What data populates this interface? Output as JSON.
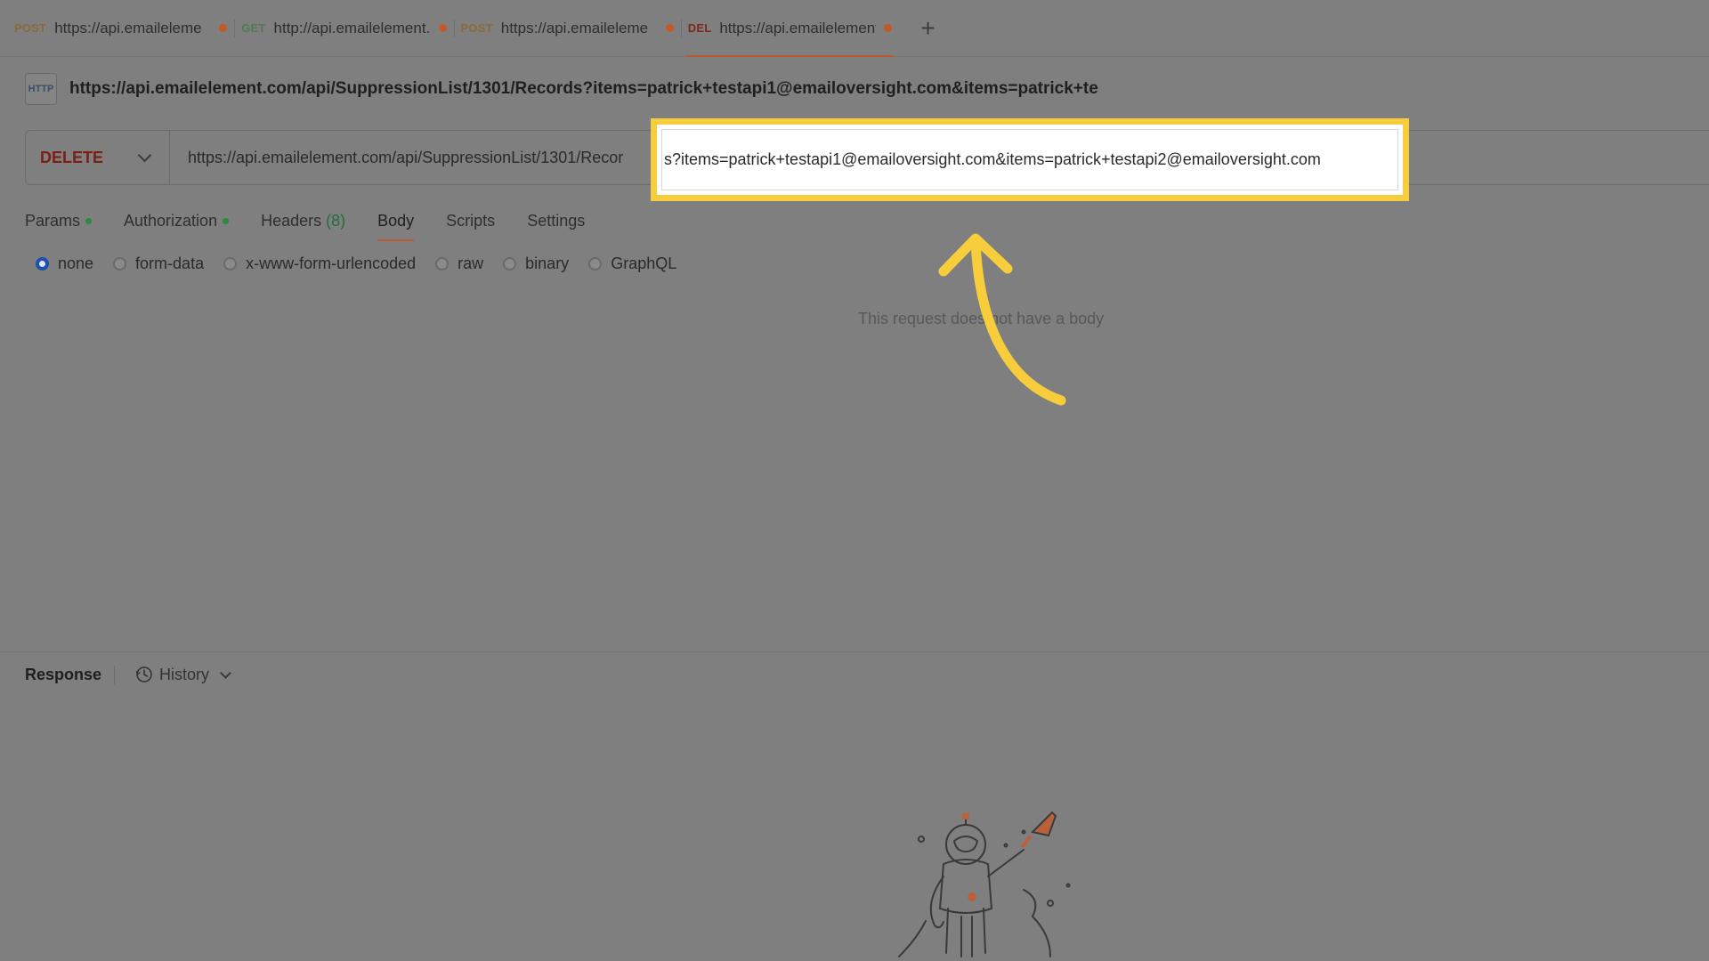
{
  "tabs": [
    {
      "method": "POST",
      "url": "https://api.emaileleme",
      "active": false
    },
    {
      "method": "GET",
      "url": "http://api.emailelement.",
      "active": false
    },
    {
      "method": "POST",
      "url": "https://api.emaileleme",
      "active": false
    },
    {
      "method": "DEL",
      "url": "https://api.emailelement",
      "active": true
    }
  ],
  "tab_add_label": "+",
  "request": {
    "icon_label": "HTTP",
    "title": "https://api.emailelement.com/api/SuppressionList/1301/Records?items=patrick+testapi1@emailoversight.com&items=patrick+te",
    "method": "DELETE",
    "url_visible": "https://api.emailelement.com/api/SuppressionList/1301/Recor",
    "url_highlighted": "s?items=patrick+testapi1@emailoversight.com&items=patrick+testapi2@emailoversight.com"
  },
  "subtabs": {
    "params": "Params",
    "authorization": "Authorization",
    "headers": "Headers",
    "headers_count": "(8)",
    "body": "Body",
    "scripts": "Scripts",
    "settings": "Settings"
  },
  "body_types": {
    "none": "none",
    "form_data": "form-data",
    "urlencoded": "x-www-form-urlencoded",
    "raw": "raw",
    "binary": "binary",
    "graphql": "GraphQL"
  },
  "no_body_message": "This request does not have a body",
  "response": {
    "title": "Response",
    "history": "History"
  },
  "colors": {
    "highlight": "#f7cd3b",
    "delete_method": "#7a1e16",
    "active_tab_underline": "#b95a34",
    "radio_selected": "#1d4fb1"
  }
}
